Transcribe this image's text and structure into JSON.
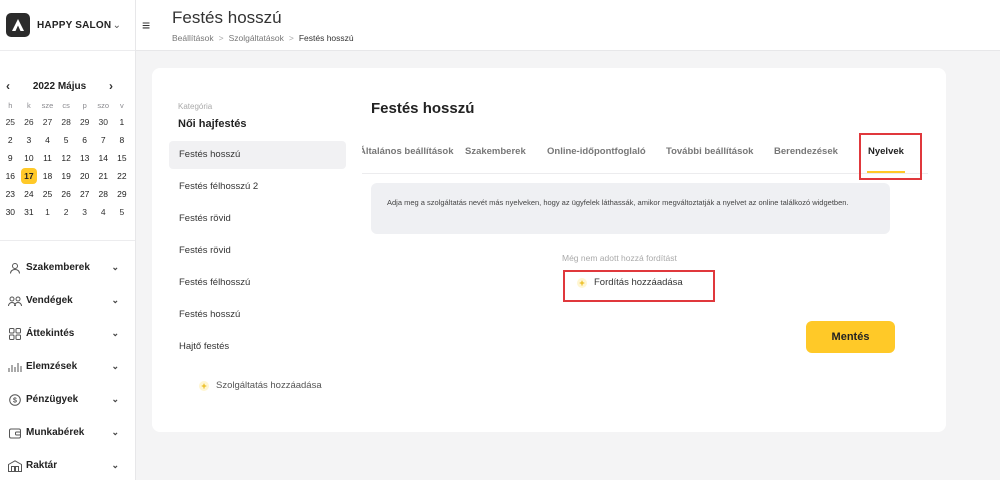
{
  "brand": {
    "name": "HAPPY SALON",
    "logo": "A-logo-icon"
  },
  "calendar": {
    "month_label": "2022 Május",
    "weekdays": [
      "h",
      "k",
      "sze",
      "cs",
      "p",
      "szo",
      "v"
    ],
    "weeks": [
      [
        "25",
        "26",
        "27",
        "28",
        "29",
        "30",
        "1"
      ],
      [
        "2",
        "3",
        "4",
        "5",
        "6",
        "7",
        "8"
      ],
      [
        "9",
        "10",
        "11",
        "12",
        "13",
        "14",
        "15"
      ],
      [
        "16",
        "17",
        "18",
        "19",
        "20",
        "21",
        "22"
      ],
      [
        "23",
        "24",
        "25",
        "26",
        "27",
        "28",
        "29"
      ],
      [
        "30",
        "31",
        "1",
        "2",
        "3",
        "4",
        "5"
      ]
    ],
    "selected_day": "17",
    "accent_color": "#ffc928"
  },
  "nav": {
    "items": [
      {
        "label": "Szakemberek",
        "icon": "person-icon"
      },
      {
        "label": "Vendégek",
        "icon": "people-icon"
      },
      {
        "label": "Áttekintés",
        "icon": "grid-icon"
      },
      {
        "label": "Elemzések",
        "icon": "chart-icon"
      },
      {
        "label": "Pénzügyek",
        "icon": "dollar-icon"
      },
      {
        "label": "Munkabérek",
        "icon": "wallet-icon"
      },
      {
        "label": "Raktár",
        "icon": "warehouse-icon"
      }
    ]
  },
  "header": {
    "title": "Festés hosszú",
    "breadcrumb": [
      "Beállítások",
      "Szolgáltatások",
      "Festés hosszú"
    ]
  },
  "category": {
    "label": "Kategória",
    "name": "Női hajfestés"
  },
  "services": [
    "Festés hosszú",
    "Festés félhosszú 2",
    "Festés rövid",
    "Festés rövid",
    "Festés félhosszú",
    "Festés hosszú",
    "Hajtő festés"
  ],
  "add_service_label": "Szolgáltatás hozzáadása",
  "detail": {
    "title": "Festés hosszú",
    "tabs": [
      "Általános beállítások",
      "Szakemberek",
      "Online-időpontfoglaló",
      "További beállítások",
      "Berendezések",
      "Nyelvek"
    ],
    "active_tab": "Nyelvek",
    "info_text": "Adja meg a szolgáltatás nevét más nyelveken, hogy az ügyfelek láthassák, amikor megváltoztatják a nyelvet az online találkozó widgetben.",
    "empty_text": "Még nem adott hozzá fordítást",
    "add_translation_label": "Fordítás hozzáadása",
    "save_label": "Mentés"
  },
  "colors": {
    "accent": "#ffc928",
    "highlight_box": "#e0383c"
  }
}
